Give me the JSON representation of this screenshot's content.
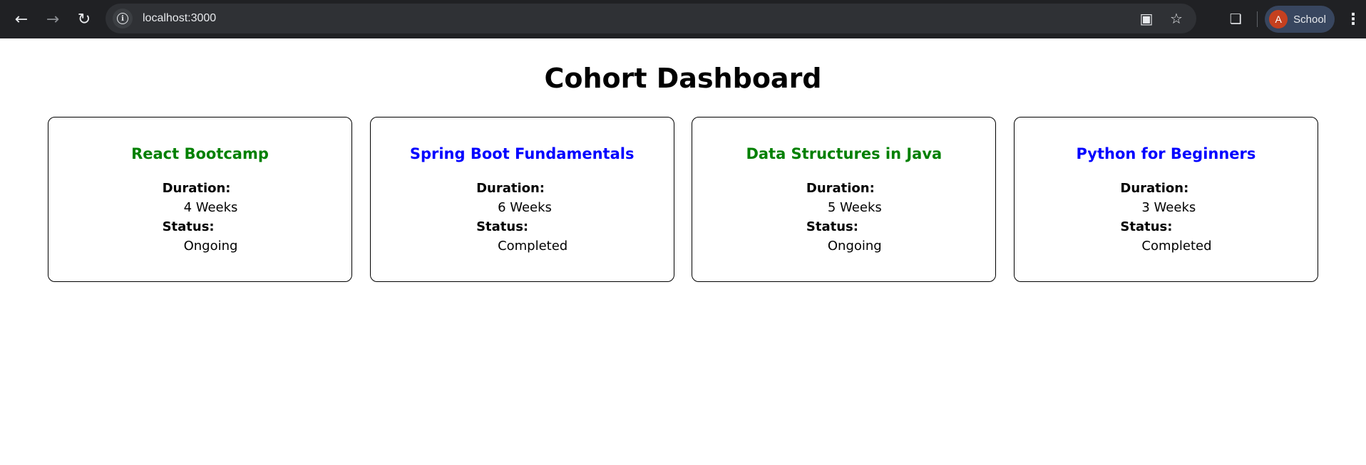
{
  "browser": {
    "url": "localhost:3000",
    "profile_initial": "A",
    "profile_name": "School"
  },
  "page": {
    "title": "Cohort Dashboard"
  },
  "cohorts": [
    {
      "name": "React Bootcamp",
      "duration_label": "Duration:",
      "duration": "4 Weeks",
      "status_label": "Status:",
      "status": "Ongoing",
      "color": "#008000"
    },
    {
      "name": "Spring Boot Fundamentals",
      "duration_label": "Duration:",
      "duration": "6 Weeks",
      "status_label": "Status:",
      "status": "Completed",
      "color": "#0000ff"
    },
    {
      "name": "Data Structures in Java",
      "duration_label": "Duration:",
      "duration": "5 Weeks",
      "status_label": "Status:",
      "status": "Ongoing",
      "color": "#008000"
    },
    {
      "name": "Python for Beginners",
      "duration_label": "Duration:",
      "duration": "3 Weeks",
      "status_label": "Status:",
      "status": "Completed",
      "color": "#0000ff"
    }
  ],
  "colors": {
    "ongoing": "#008000",
    "completed": "#0000ff",
    "chrome_bg": "#202124"
  }
}
